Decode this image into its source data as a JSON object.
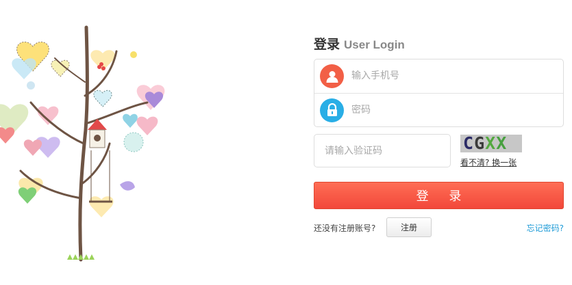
{
  "login": {
    "title_cn": "登录",
    "title_en": "User Login",
    "phone_placeholder": "输入手机号",
    "password_placeholder": "密码",
    "captcha_placeholder": "请输入验证码",
    "captcha_text": [
      "C",
      "G",
      "X",
      "X"
    ],
    "refresh_link": "看不清? 换一张",
    "submit_label": "登 录",
    "no_account_text": "还没有注册账号?",
    "register_label": "注册",
    "forgot_link": "忘记密码?"
  },
  "icons": {
    "user": "user-icon",
    "lock": "lock-icon",
    "illustration": "decorative-tree-illustration"
  },
  "colors": {
    "accent_red": "#f25f46",
    "accent_blue": "#29aee6",
    "link_blue": "#1e9bd7",
    "button_red": "#f2483a"
  }
}
